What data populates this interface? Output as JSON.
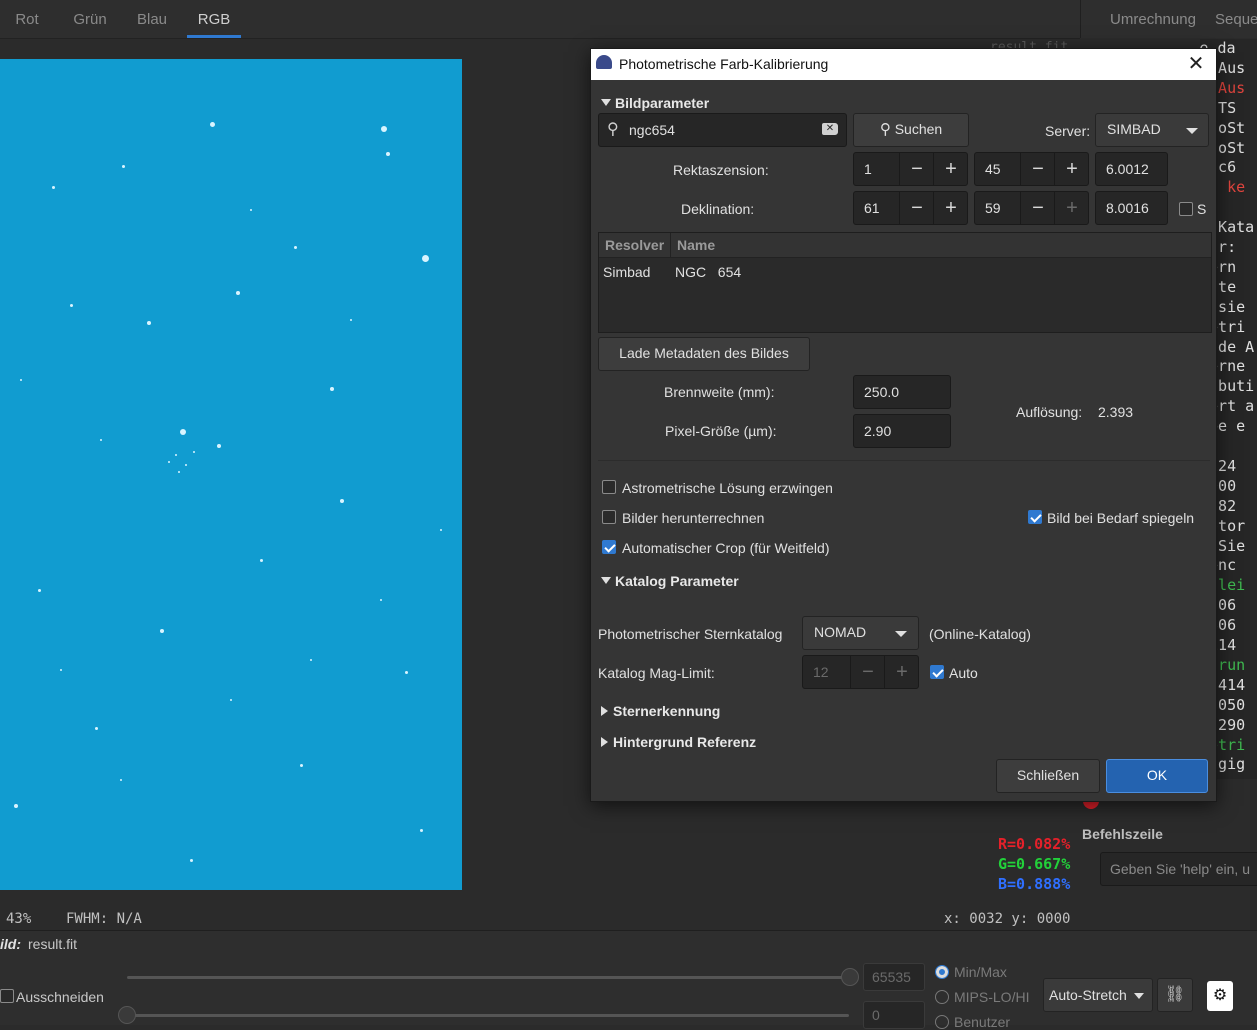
{
  "tabs": [
    "Rot",
    "Grün",
    "Blau",
    "RGB"
  ],
  "right_tabs": [
    "Umrechnung",
    "Seque"
  ],
  "result_ghost": "result.fit",
  "console_lines": [
    {
      "text": "15:01:05: Lege da",
      "color": "#e0e0e0"
    },
    {
      "text": "t-Aus",
      "color": "#e0e0e0"
    },
    {
      "text": "t Aus",
      "color": "#e0453e"
    },
    {
      "text": "FITS",
      "color": "#e0e0e0"
    },
    {
      "text": "utoSt",
      "color": "#e0e0e0"
    },
    {
      "text": "utoSt",
      "color": "#e0e0e0"
    },
    {
      "text": " ngc6",
      "color": "#e0e0e0"
    },
    {
      "text": "bt ke",
      "color": "#e0453e"
    },
    {
      "text": "",
      "color": "#e0e0e0"
    },
    {
      "text": ") Kata",
      "color": "#e0e0e0"
    },
    {
      "text": "tar:",
      "color": "#e0e0e0"
    },
    {
      "text": "hern",
      "color": "#e0e0e0"
    },
    {
      "text": "itte",
      "color": "#e0e0e0"
    },
    {
      "text": "lisie",
      "color": "#e0e0e0"
    },
    {
      "text": "metri",
      "color": "#e0e0e0"
    },
    {
      "text": "ende A",
      "color": "#e0e0e0"
    },
    {
      "text": "terne",
      "color": "#e0e0e0"
    },
    {
      "text": "ributi",
      "color": "#e0e0e0"
    },
    {
      "text": "wert a",
      "color": "#e0e0e0"
    },
    {
      "text": "abe e",
      "color": "#e0e0e0"
    },
    {
      "text": "",
      "color": "#e0e0e0"
    },
    {
      "text": ".124",
      "color": "#e0e0e0"
    },
    {
      "text": ".000",
      "color": "#e0e0e0"
    },
    {
      "text": ".382",
      "color": "#e0e0e0"
    },
    {
      "text": "hotor",
      "color": "#e0e0e0"
    },
    {
      "text": "n Sie",
      "color": "#e0e0e0"
    },
    {
      "text": " renc",
      "color": "#e0e0e0"
    },
    {
      "text": "bglei",
      "color": "#3fb950"
    },
    {
      "text": ".906",
      "color": "#e0e0e0"
    },
    {
      "text": ".806",
      "color": "#e0e0e0"
    },
    {
      "text": ".114",
      "color": "#e0e0e0"
    },
    {
      "text": "rgrun",
      "color": "#3fb950"
    },
    {
      "text": "4.414",
      "color": "#e0e0e0"
    },
    {
      "text": "4.050",
      "color": "#e0e0e0"
    },
    {
      "text": "8.290",
      "color": "#e0e0e0"
    },
    {
      "text": "metri",
      "color": "#3fb950"
    },
    {
      "text": "ängig",
      "color": "#e0e0e0"
    }
  ],
  "dialog": {
    "title": "Photometrische Farb-Kalibrierung",
    "section_image": "Bildparameter",
    "search_value": "ngc654",
    "search_button": "Suchen",
    "server_label": "Server:",
    "server_value": "SIMBAD",
    "ra_label": "Rektaszension:",
    "ra": {
      "h": "1",
      "m": "45",
      "s": "6.0012"
    },
    "dec_label": "Deklination:",
    "dec": {
      "d": "61",
      "m": "59",
      "s": "8.0016"
    },
    "dec_south_label": "S",
    "table_headers": [
      "Resolver",
      "Name"
    ],
    "table_rows": [
      {
        "resolver": "Simbad",
        "name": "NGC   654"
      }
    ],
    "load_metadata": "Lade Metadaten des Bildes",
    "focal_label": "Brennweite (mm):",
    "focal_value": "250.0",
    "pixel_label": "Pixel-Größe (µm):",
    "pixel_value": "2.90",
    "resolution_label": "Auflösung:",
    "resolution_value": "2.393",
    "cb_force": "Astrometrische Lösung erzwingen",
    "cb_downsample": "Bilder herunterrechnen",
    "cb_flip": "Bild bei Bedarf spiegeln",
    "cb_autocrop": "Automatischer Crop (für Weitfeld)",
    "section_catalog": "Katalog Parameter",
    "catalog_label": "Photometrischer Sternkatalog",
    "catalog_value": "NOMAD",
    "catalog_note": "(Online-Katalog)",
    "mag_label": "Katalog Mag-Limit:",
    "mag_value": "12",
    "mag_auto": "Auto",
    "section_star": "Sternerkennung",
    "section_bg": "Hintergrund Referenz",
    "close_button": "Schließen",
    "ok_button": "OK"
  },
  "rgb_readout": {
    "r": "R=0.082%",
    "g": "G=0.667%",
    "b": "B=0.888%"
  },
  "status": {
    "zoom": "43%",
    "fwhm": "FWHM: N/A",
    "coords": "x: 0032 y: 0000"
  },
  "image_label_key": "ild:",
  "image_label_value": "result.fit",
  "command_header": "Befehlszeile",
  "command_placeholder": "Geben Sie 'help' ein, u",
  "bottom": {
    "crop_label": "Ausschneiden",
    "max_value": "65535",
    "min_value": "0",
    "radio_minmax": "Min/Max",
    "radio_mips": "MIPS-LO/HI",
    "radio_user": "Benutzer",
    "stretch": "Auto-Stretch"
  },
  "colors": {
    "accent": "#2f79d0",
    "image": "#119cd0",
    "red": "#e5202a",
    "green": "#22d13a",
    "blue": "#2f6fff"
  }
}
